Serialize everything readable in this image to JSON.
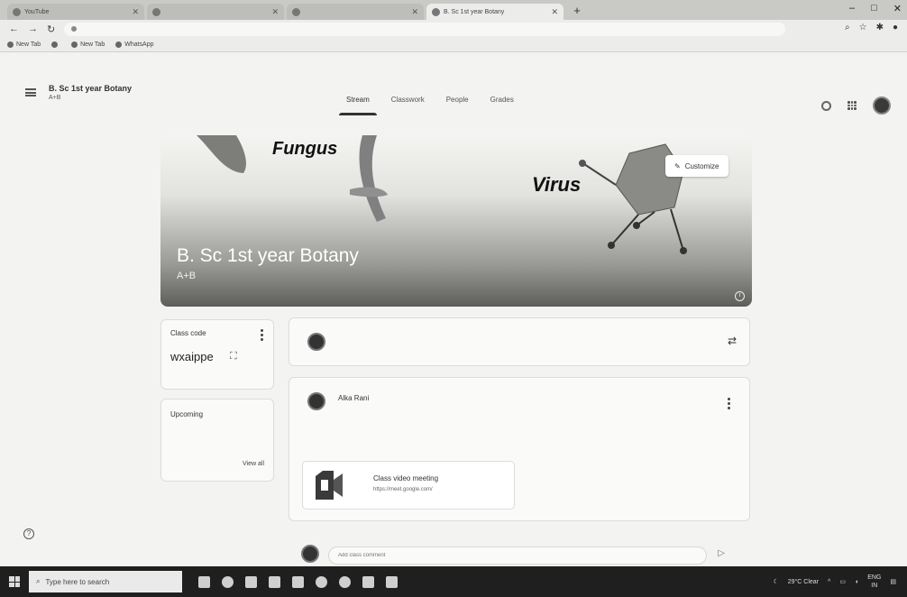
{
  "browser": {
    "tabs": [
      {
        "label": "YouTube",
        "active": false
      },
      {
        "label": "",
        "active": false
      },
      {
        "label": "",
        "active": false
      },
      {
        "label": "B. Sc 1st year Botany",
        "active": true
      }
    ],
    "address": "",
    "bookmarks": [
      "New Tab",
      "",
      "New Tab",
      "WhatsApp"
    ],
    "window_controls": [
      "–",
      "□",
      "✕"
    ]
  },
  "classroom": {
    "class_name": "B. Sc 1st year Botany",
    "section": "A+B",
    "nav_tabs": [
      "Stream",
      "Classwork",
      "People",
      "Grades"
    ],
    "active_tab": "Stream",
    "banner": {
      "title": "B. Sc 1st year Botany",
      "section": "A+B",
      "art_word_1": "Fungus",
      "art_word_2": "Virus",
      "customize_label": "Customize"
    },
    "class_code": {
      "label": "Class code",
      "value": "wxaippe"
    },
    "upcoming": {
      "label": "Upcoming",
      "note": "",
      "view_all": "View all"
    },
    "announce_placeholder": "",
    "post": {
      "author": "Alka Rani",
      "date": "",
      "line1": "",
      "line2": "",
      "attachment_title": "Class video meeting",
      "attachment_url": "https://meet.google.com/"
    },
    "comment_placeholder": "Add class comment"
  },
  "taskbar": {
    "search_placeholder": "Type here to search",
    "weather": "29°C Clear",
    "lang": "ENG",
    "lang_region": "IN"
  },
  "colors": {
    "meet_green": "#3a3a3a",
    "active_tab_indicator": "#333333"
  }
}
